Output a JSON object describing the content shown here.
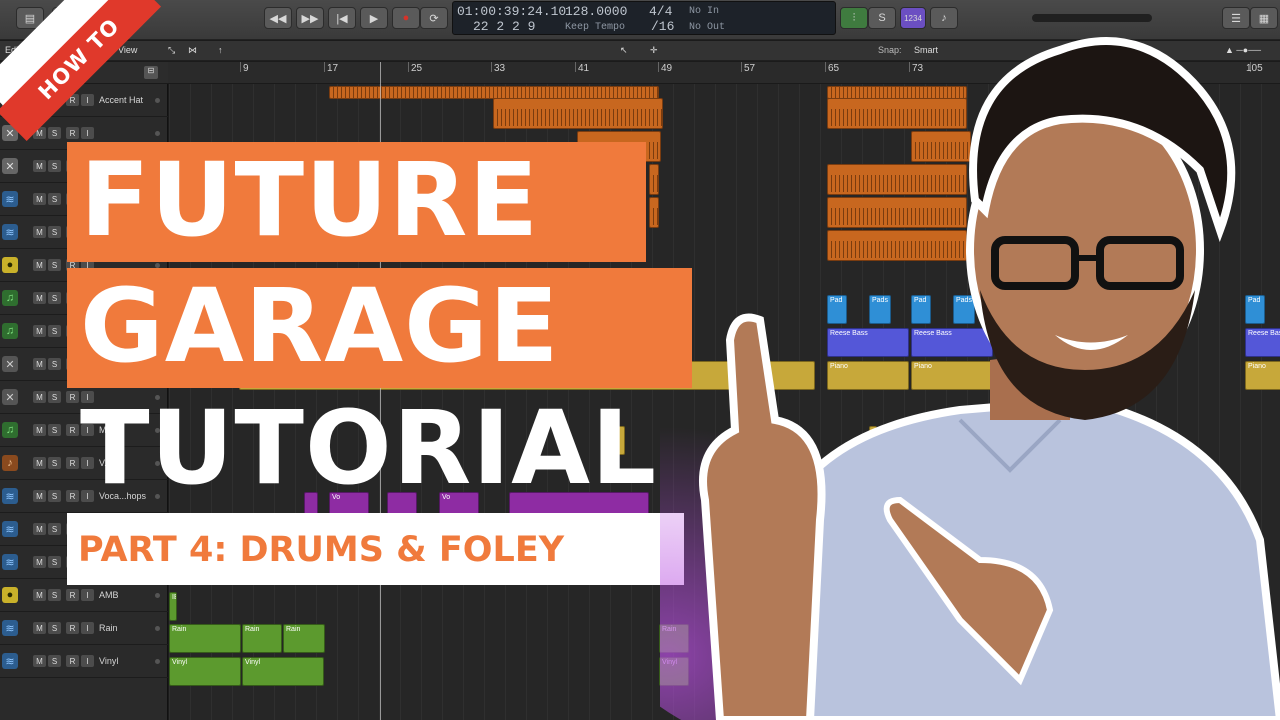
{
  "colors": {
    "accent_orange": "#f07a3c",
    "banner_red": "#e0392b",
    "region_orange": "#c8671f",
    "region_blue": "#5457d8",
    "region_yellow": "#c7a83a"
  },
  "banner": {
    "label": "HOW TO"
  },
  "title": {
    "line1": "FUTURE",
    "line2": "GARAGE",
    "line3": "TUTORIAL"
  },
  "subtitle": "PART 4: DRUMS & FOLEY",
  "lcd": {
    "time": "01:00:39:24.10",
    "position": "22  2  2      9",
    "tempo": "128.0000",
    "tempo_label": "Keep Tempo",
    "signature": "4/4",
    "division": "/16",
    "in": "No In",
    "out": "No Out"
  },
  "toolbar": {
    "edit": "Edit",
    "functions": "F",
    "view": "View",
    "snap_label": "Snap:",
    "snap_value": "Smart",
    "count_in": "1234"
  },
  "ruler": [
    "9",
    "17",
    "25",
    "33",
    "41",
    "49",
    "57",
    "65",
    "73",
    "105"
  ],
  "tracks": [
    {
      "name": "Accent Hat",
      "icon": "drum-icon"
    },
    {
      "name": "",
      "icon": "drum-icon"
    },
    {
      "name": "",
      "icon": "drum-icon"
    },
    {
      "name": "",
      "icon": "audio-wave-icon"
    },
    {
      "name": "",
      "icon": "audio-wave-icon"
    },
    {
      "name": "",
      "icon": "drummer-icon"
    },
    {
      "name": "",
      "icon": "midi-note-icon"
    },
    {
      "name": "",
      "icon": "midi-note-icon"
    },
    {
      "name": "",
      "icon": "plugin-icon"
    },
    {
      "name": "",
      "icon": "plugin-icon"
    },
    {
      "name": "M...s",
      "icon": "midi-note-icon"
    },
    {
      "name": "V...",
      "icon": "violin-icon"
    },
    {
      "name": "Voca...hops",
      "icon": "audio-wave-icon"
    },
    {
      "name": "",
      "icon": "audio-wave-icon"
    },
    {
      "name": "",
      "icon": "audio-wave-icon"
    },
    {
      "name": "AMB",
      "icon": "drummer-icon"
    },
    {
      "name": "Rain",
      "icon": "audio-wave-icon"
    },
    {
      "name": "Vinyl",
      "icon": "audio-wave-icon"
    }
  ],
  "track_buttons": {
    "mute": "M",
    "solo": "S",
    "record": "R",
    "input": "I"
  },
  "regions": {
    "pad": "Pad",
    "pads": "Pads",
    "reese": "Reese Bass",
    "piano": "Piano",
    "vo": "Vo",
    "violin": "olin",
    "amb": "IB",
    "rain": "Rain",
    "vinyl": "Vinyl"
  }
}
